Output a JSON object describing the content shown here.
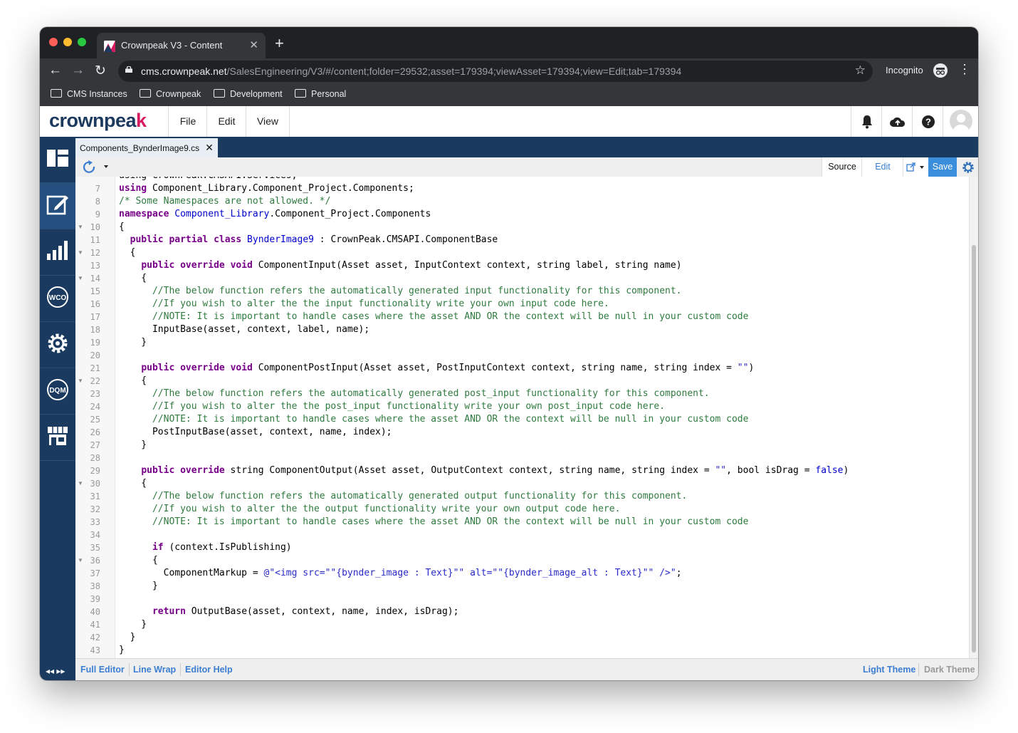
{
  "browser": {
    "tab_title": "Crownpeak V3 - Content",
    "url_host": "cms.crownpeak.net",
    "url_path": "/SalesEngineering/V3/#/content;folder=29532;asset=179394;viewAsset=179394;view=Edit;tab=179394",
    "mode_label": "Incognito",
    "bookmarks": [
      "CMS Instances",
      "Crownpeak",
      "Development",
      "Personal"
    ]
  },
  "app": {
    "logo_main": "crownpea",
    "logo_accent": "k",
    "menu": [
      "File",
      "Edit",
      "View"
    ]
  },
  "sidebar": {
    "items": [
      "dashboard",
      "edit",
      "reports",
      "WCO",
      "settings",
      "DQM",
      "marketplace"
    ],
    "wco_label": "WCO",
    "dqm_label": "DQM"
  },
  "document": {
    "tab_label": "Components_BynderImage9.cs"
  },
  "editor_toolbar": {
    "source_label": "Source",
    "edit_label": "Edit",
    "save_label": "Save"
  },
  "footer": {
    "full_editor": "Full Editor",
    "line_wrap": "Line Wrap",
    "editor_help": "Editor Help",
    "light_theme": "Light Theme",
    "dark_theme": "Dark Theme"
  },
  "code": {
    "partial_top_line": "using CrownPeak.CMSAPI.Services;",
    "lines": [
      {
        "n": "7",
        "fold": false,
        "html": "<span class=\"k\">using</span> Component_Library.Component_Project.Components;"
      },
      {
        "n": "8",
        "fold": false,
        "html": "<span class=\"c\">/* Some Namespaces are not allowed. */</span>"
      },
      {
        "n": "9",
        "fold": false,
        "html": "<span class=\"k\">namespace</span> <span class=\"t\">Component_Library</span>.Component_Project.Components"
      },
      {
        "n": "10",
        "fold": true,
        "html": "{"
      },
      {
        "n": "11",
        "fold": false,
        "html": "  <span class=\"k\">public</span> <span class=\"k\">partial</span> <span class=\"k\">class</span> <span class=\"t\">BynderImage9</span> : CrownPeak.CMSAPI.ComponentBase"
      },
      {
        "n": "12",
        "fold": true,
        "html": "  {"
      },
      {
        "n": "13",
        "fold": false,
        "html": "    <span class=\"k\">public</span> <span class=\"k\">override</span> <span class=\"k\">void</span> ComponentInput(Asset asset, InputContext context, string label, string name)"
      },
      {
        "n": "14",
        "fold": true,
        "html": "    {"
      },
      {
        "n": "15",
        "fold": false,
        "html": "      <span class=\"c\">//The below function refers the automatically generated input functionality for this component.</span>"
      },
      {
        "n": "16",
        "fold": false,
        "html": "      <span class=\"c\">//If you wish to alter the the input functionality write your own input code here.</span>"
      },
      {
        "n": "17",
        "fold": false,
        "html": "      <span class=\"c\">//NOTE: It is important to handle cases where the asset AND OR the context will be null in your custom code</span>"
      },
      {
        "n": "18",
        "fold": false,
        "html": "      InputBase(asset, context, label, name);"
      },
      {
        "n": "19",
        "fold": false,
        "html": "    }"
      },
      {
        "n": "20",
        "fold": false,
        "html": ""
      },
      {
        "n": "21",
        "fold": false,
        "html": "    <span class=\"k\">public</span> <span class=\"k\">override</span> <span class=\"k\">void</span> ComponentPostInput(Asset asset, PostInputContext context, string name, string index = <span class=\"s\">\"\"</span>)"
      },
      {
        "n": "22",
        "fold": true,
        "html": "    {"
      },
      {
        "n": "23",
        "fold": false,
        "html": "      <span class=\"c\">//The below function refers the automatically generated post_input functionality for this component.</span>"
      },
      {
        "n": "24",
        "fold": false,
        "html": "      <span class=\"c\">//If you wish to alter the the post_input functionality write your own post_input code here.</span>"
      },
      {
        "n": "25",
        "fold": false,
        "html": "      <span class=\"c\">//NOTE: It is important to handle cases where the asset AND OR the context will be null in your custom code</span>"
      },
      {
        "n": "26",
        "fold": false,
        "html": "      PostInputBase(asset, context, name, index);"
      },
      {
        "n": "27",
        "fold": false,
        "html": "    }"
      },
      {
        "n": "28",
        "fold": false,
        "html": ""
      },
      {
        "n": "29",
        "fold": false,
        "html": "    <span class=\"k\">public</span> <span class=\"k\">override</span> string ComponentOutput(Asset asset, OutputContext context, string name, string index = <span class=\"s\">\"\"</span>, bool isDrag = <span class=\"t\">false</span>)"
      },
      {
        "n": "30",
        "fold": true,
        "html": "    {"
      },
      {
        "n": "31",
        "fold": false,
        "html": "      <span class=\"c\">//The below function refers the automatically generated output functionality for this component.</span>"
      },
      {
        "n": "32",
        "fold": false,
        "html": "      <span class=\"c\">//If you wish to alter the the output functionality write your own output code here.</span>"
      },
      {
        "n": "33",
        "fold": false,
        "html": "      <span class=\"c\">//NOTE: It is important to handle cases where the asset AND OR the context will be null in your custom code</span>"
      },
      {
        "n": "34",
        "fold": false,
        "html": ""
      },
      {
        "n": "35",
        "fold": false,
        "html": "      <span class=\"k\">if</span> (context.IsPublishing)"
      },
      {
        "n": "36",
        "fold": true,
        "html": "      {"
      },
      {
        "n": "37",
        "fold": false,
        "html": "        ComponentMarkup = <span class=\"s\">@\"&lt;img src=\"\"{bynder_image : Text}\"\" alt=\"\"{bynder_image_alt : Text}\"\" /&gt;\"</span>;"
      },
      {
        "n": "38",
        "fold": false,
        "html": "      }"
      },
      {
        "n": "39",
        "fold": false,
        "html": ""
      },
      {
        "n": "40",
        "fold": false,
        "html": "      <span class=\"k\">return</span> OutputBase(asset, context, name, index, isDrag);"
      },
      {
        "n": "41",
        "fold": false,
        "html": "    }"
      },
      {
        "n": "42",
        "fold": false,
        "html": "  }"
      },
      {
        "n": "43",
        "fold": false,
        "html": "}"
      }
    ]
  },
  "colors": {
    "navy": "#1a3a5f",
    "accent_blue": "#3b7ed1",
    "keyword": "#770088",
    "comment": "#2f7a3f"
  }
}
